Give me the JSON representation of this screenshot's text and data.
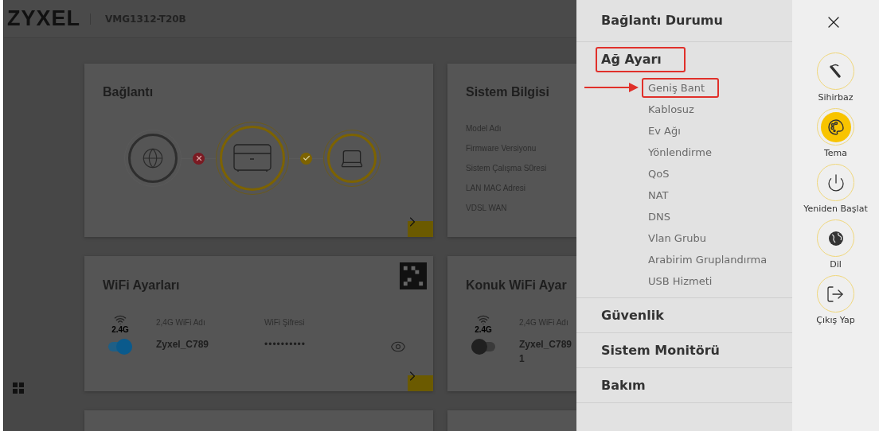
{
  "header": {
    "logo": "ZYXEL",
    "model": "VMG1312-T20B"
  },
  "connection_card": {
    "title": "Bağlantı",
    "links": [
      {
        "kind": "error"
      },
      {
        "kind": "ok"
      }
    ]
  },
  "system_info_card": {
    "title": "Sistem Bilgisi",
    "labels": [
      "Model Adı",
      "Firmware Versiyonu",
      "Sistem Çalışma S0resi",
      "LAN MAC Adresi",
      "VDSL WAN"
    ]
  },
  "wifi_card": {
    "title": "WiFi Ayarları",
    "band": "2.4G",
    "name_label": "2,4G WiFi Adı",
    "password_label": "WiFi Şifresi",
    "ssid": "Zyxel_C789",
    "password": "••••••••••",
    "on": true
  },
  "guest_wifi_card": {
    "title": "Konuk WiFi Ayar",
    "band": "2.4G",
    "name_label": "2,4G WiFi Adı",
    "ssid": "Zyxel_C7891",
    "on": false
  },
  "menu": [
    {
      "label": "Bağlantı Durumu",
      "annotated": false
    },
    {
      "label": "Ağ Ayarı",
      "annotated": true,
      "children": [
        {
          "label": "Geniş Bant",
          "annotated": true
        },
        {
          "label": "Kablosuz",
          "annotated": false
        },
        {
          "label": "Ev Ağı",
          "annotated": false
        },
        {
          "label": "Yönlendirme",
          "annotated": false
        },
        {
          "label": "QoS",
          "annotated": false
        },
        {
          "label": "NAT",
          "annotated": false
        },
        {
          "label": "DNS",
          "annotated": false
        },
        {
          "label": "Vlan Grubu",
          "annotated": false
        },
        {
          "label": "Arabirim Gruplandırma",
          "annotated": false
        },
        {
          "label": "USB Hizmeti",
          "annotated": false
        }
      ]
    },
    {
      "label": "Güvenlik",
      "annotated": false
    },
    {
      "label": "Sistem Monitörü",
      "annotated": false
    },
    {
      "label": "Bakım",
      "annotated": false
    }
  ],
  "actions": [
    {
      "kind": "wizard",
      "label": "Sihirbaz",
      "selected": false
    },
    {
      "kind": "theme",
      "label": "Tema",
      "selected": true
    },
    {
      "kind": "restart",
      "label": "Yeniden Başlat",
      "selected": false
    },
    {
      "kind": "language",
      "label": "Dil",
      "selected": false
    },
    {
      "kind": "logout",
      "label": "Çıkış Yap",
      "selected": false
    }
  ]
}
